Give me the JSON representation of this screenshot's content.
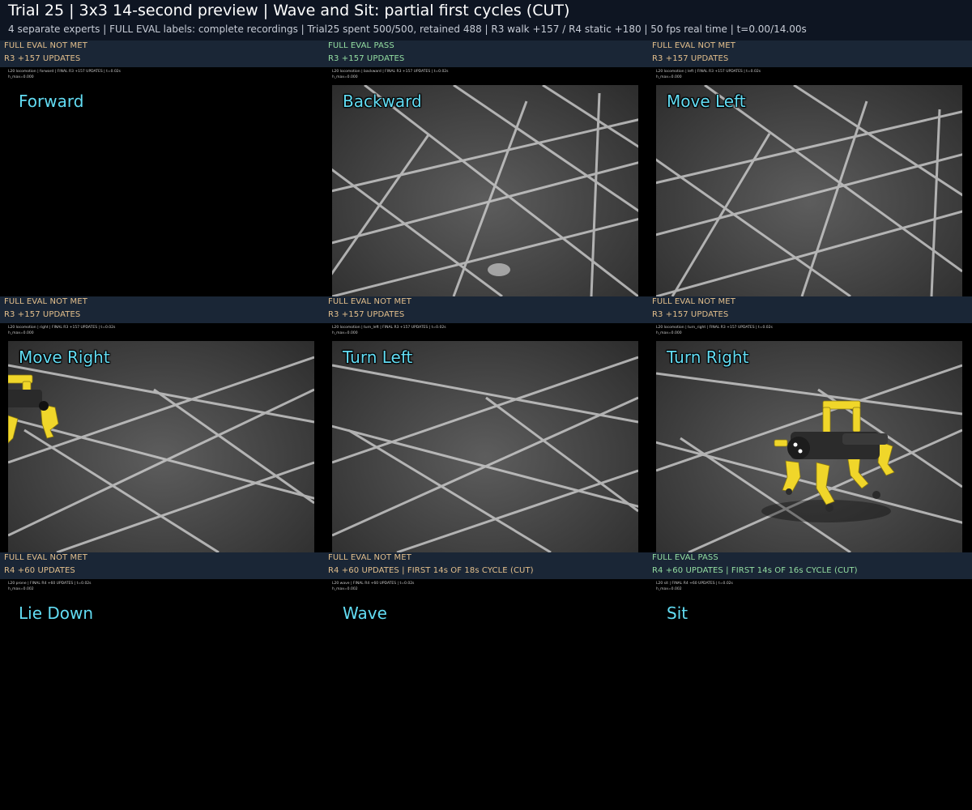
{
  "header": {
    "title": "Trial 25 | 3x3 14-second preview | Wave and Sit: partial first cycles (CUT)",
    "subtitle": "4 separate experts | FULL EVAL labels: complete recordings | Trial25 spent 500/500, retained 488 | R3 walk +157 / R4 static +180 | 50 fps real time | t=0.00/14.00s"
  },
  "cells": [
    {
      "eval_status": "FULL EVAL NOT MET",
      "status_kind": "not-met",
      "updates": "R3 +157 UPDATES",
      "overlay_line1": "L20 locomotion | forward | FINAL R3 +157 UPDATES | t=0.02s",
      "overlay_line2": "h_max=0.000",
      "command": "Forward",
      "has_video": false,
      "robot": "none"
    },
    {
      "eval_status": "FULL EVAL PASS",
      "status_kind": "pass",
      "updates": "R3 +157 UPDATES",
      "overlay_line1": "L20 locomotion | backward | FINAL R3 +157 UPDATES | t=0.02s",
      "overlay_line2": "h_max=0.000",
      "command": "Backward",
      "has_video": true,
      "robot": "none"
    },
    {
      "eval_status": "FULL EVAL NOT MET",
      "status_kind": "not-met",
      "updates": "R3 +157 UPDATES",
      "overlay_line1": "L20 locomotion | left | FINAL R3 +157 UPDATES | t=0.02s",
      "overlay_line2": "h_max=0.000",
      "command": "Move Left",
      "has_video": true,
      "robot": "none"
    },
    {
      "eval_status": "FULL EVAL NOT MET",
      "status_kind": "not-met",
      "updates": "R3 +157 UPDATES",
      "overlay_line1": "L20 locomotion | right | FINAL R3 +157 UPDATES | t=0.02s",
      "overlay_line2": "h_max=0.000",
      "command": "Move Right",
      "has_video": true,
      "robot": "partial-left"
    },
    {
      "eval_status": "FULL EVAL NOT MET",
      "status_kind": "not-met",
      "updates": "R3 +157 UPDATES",
      "overlay_line1": "L20 locomotion | turn_left | FINAL R3 +157 UPDATES | t=0.02s",
      "overlay_line2": "h_max=0.000",
      "command": "Turn Left",
      "has_video": true,
      "robot": "none"
    },
    {
      "eval_status": "FULL EVAL NOT MET",
      "status_kind": "not-met",
      "updates": "R3 +157 UPDATES",
      "overlay_line1": "L20 locomotion | turn_right | FINAL R3 +157 UPDATES | t=0.02s",
      "overlay_line2": "h_max=0.000",
      "command": "Turn Right",
      "has_video": true,
      "robot": "full"
    },
    {
      "eval_status": "FULL EVAL NOT MET",
      "status_kind": "not-met",
      "updates": "R4 +60 UPDATES",
      "overlay_line1": "L20 prone | FINAL R4 +60 UPDATES | t=0.02s",
      "overlay_line2": "h_max=0.002",
      "command": "Lie Down",
      "has_video": false,
      "robot": "none"
    },
    {
      "eval_status": "FULL EVAL NOT MET",
      "status_kind": "not-met",
      "updates": "R4 +60 UPDATES | FIRST 14s OF 18s CYCLE (CUT)",
      "overlay_line1": "L20 wave | FINAL R4 +60 UPDATES | t=0.02s",
      "overlay_line2": "h_max=0.002",
      "command": "Wave",
      "has_video": false,
      "robot": "none"
    },
    {
      "eval_status": "FULL EVAL PASS",
      "status_kind": "pass",
      "updates": "R4 +60 UPDATES | FIRST 14s OF 16s CYCLE (CUT)",
      "overlay_line1": "L20 sit | FINAL R4 +60 UPDATES | t=0.02s",
      "overlay_line2": "h_max=0.002",
      "command": "Sit",
      "has_video": false,
      "robot": "none"
    }
  ],
  "colors": {
    "header_bg": "#0e1522",
    "bar_bg": "#1a2636",
    "not_met": "#e3bf8c",
    "pass": "#94dfa2",
    "command_label": "#62dcf3",
    "robot_body": "#f0d62a"
  }
}
